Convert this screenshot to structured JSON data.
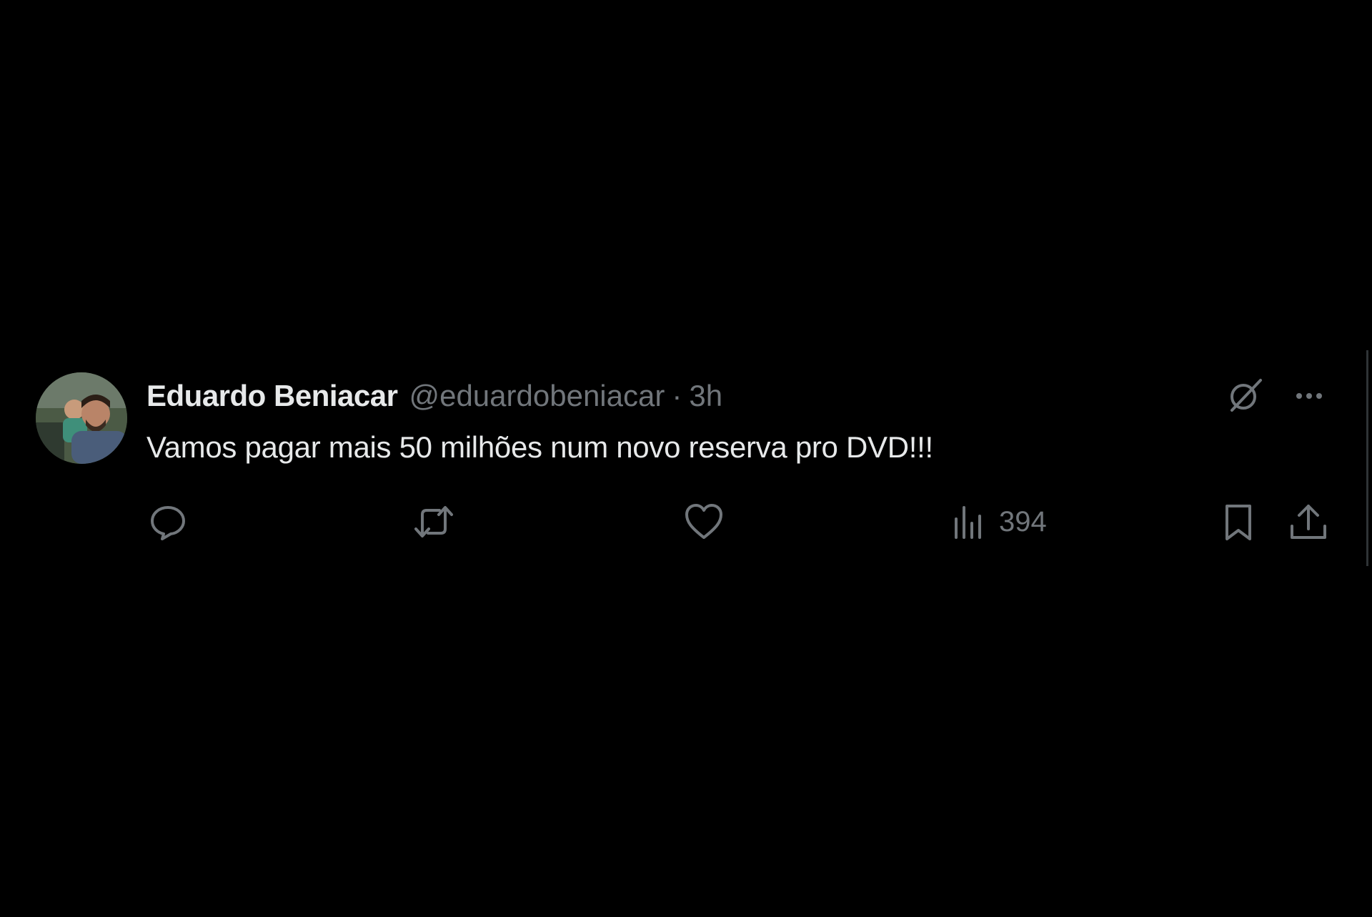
{
  "tweet": {
    "display_name": "Eduardo Beniacar",
    "handle": "@eduardobeniacar",
    "separator": "·",
    "time": "3h",
    "text": "Vamos pagar mais 50 milhões num novo reserva pro DVD!!!",
    "views_count": "394"
  },
  "icons": {
    "grok": "grok-icon",
    "more": "more-icon",
    "reply": "reply-icon",
    "retweet": "retweet-icon",
    "like": "like-icon",
    "views": "views-icon",
    "bookmark": "bookmark-icon",
    "share": "share-icon"
  },
  "colors": {
    "background": "#000000",
    "primary_text": "#e7e9ea",
    "secondary_text": "#71767b"
  }
}
